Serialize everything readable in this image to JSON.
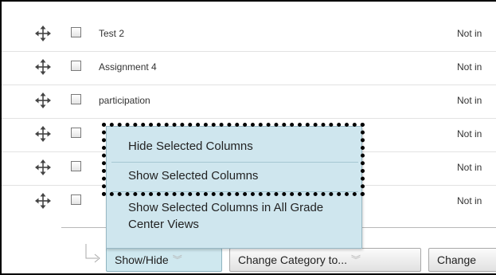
{
  "rows": [
    {
      "name": "Test 2",
      "status": "Not in"
    },
    {
      "name": "Assignment 4",
      "status": "Not in"
    },
    {
      "name": "participation",
      "status": "Not in"
    },
    {
      "name": "",
      "status": "Not in"
    },
    {
      "name": "",
      "status": "Not in"
    },
    {
      "name": "",
      "status": "Not in"
    }
  ],
  "menu": {
    "items": [
      "Hide Selected Columns",
      "Show Selected Columns",
      "Show Selected Columns in All Grade Center Views"
    ],
    "focused_index": 0
  },
  "toolbar": {
    "show_hide_label": "Show/Hide",
    "change_category_label": "Change Category to...",
    "change_label": "Change"
  },
  "icons": {
    "move": "four-way-arrow-icon",
    "checkbox": "checkbox-icon",
    "chevron": "double-chevron-down-icon",
    "elbow": "elbow-arrow-icon"
  },
  "colors": {
    "menu_bg": "#cfe6ee",
    "button_active_bg": "#cfe8ef",
    "focus_ring": "#000000"
  }
}
